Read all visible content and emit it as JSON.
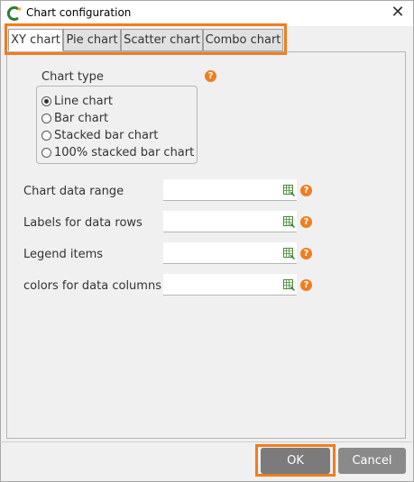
{
  "window": {
    "title": "Chart configuration",
    "close_symbol": "✕"
  },
  "tabs": [
    {
      "label": "XY chart",
      "active": true
    },
    {
      "label": "Pie chart",
      "active": false
    },
    {
      "label": "Scatter chart",
      "active": false
    },
    {
      "label": "Combo chart",
      "active": false
    }
  ],
  "chart_type": {
    "label": "Chart type",
    "options": [
      {
        "label": "Line chart",
        "selected": true
      },
      {
        "label": "Bar chart",
        "selected": false
      },
      {
        "label": "Stacked bar chart",
        "selected": false
      },
      {
        "label": "100% stacked bar chart",
        "selected": false
      }
    ]
  },
  "fields": [
    {
      "label": "Chart data range",
      "value": ""
    },
    {
      "label": "Labels for data rows",
      "value": ""
    },
    {
      "label": "Legend items",
      "value": ""
    },
    {
      "label": "colors for data columns",
      "value": ""
    }
  ],
  "help_symbol": "?",
  "buttons": {
    "ok": "OK",
    "cancel": "Cancel"
  },
  "colors": {
    "highlight": "#f07d1e",
    "help": "#f07d1e"
  },
  "icons": {
    "app": "chart-app-icon",
    "help": "help-icon",
    "range": "range-select-icon",
    "close": "close-icon"
  }
}
